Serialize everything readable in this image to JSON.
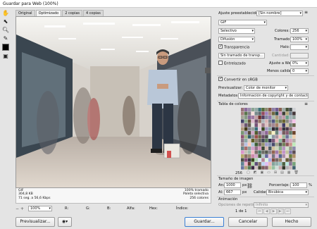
{
  "window": {
    "title": "Guardar para Web (100%)"
  },
  "tabs": [
    {
      "label": "Original"
    },
    {
      "label": "Optimizado"
    },
    {
      "label": "2 copias"
    },
    {
      "label": "4 copias"
    }
  ],
  "status": {
    "format": "GIF",
    "size": "304,8 KB",
    "time": "71 seg. a 56,6 Kbps",
    "dither": "100% tramado",
    "palette": "Paleta selectiva",
    "colors": "256 colores"
  },
  "bottom": {
    "zoom": "100%",
    "r": "R:",
    "g": "G:",
    "b": "B:",
    "alpha": "Alfa:",
    "hex": "Hex:",
    "index": "Índice:"
  },
  "panel": {
    "preset_label": "Ajuste preestablecido:",
    "preset_value": "[Sin nombre]",
    "format": "GIF",
    "reduction": "Selectivo",
    "dither_algo": "Difusión",
    "colors_label": "Colores:",
    "colors_value": "256",
    "dither_label": "Tramado:",
    "dither_value": "100%",
    "transparency": "Transparencia",
    "halo_label": "Halo:",
    "transp_dither": "Sin tramado de transp...",
    "amount_label": "Cantidad:",
    "interlaced": "Entrelazado",
    "web_snap_label": "Ajuste a Web:",
    "web_snap_value": "0%",
    "lossy_label": "Menos calidad:",
    "lossy_value": "0",
    "convert_srgb": "Convertir en sRGB",
    "preview_label": "Previsualizar:",
    "preview_value": "Color de monitor",
    "metadata_label": "Metadatos:",
    "metadata_value": "Información de copyright y de contacto",
    "color_table_title": "Tabla de colores",
    "color_count": "256",
    "image_size_title": "Tamaño de imagen",
    "width_label": "An:",
    "width_value": "1000",
    "height_label": "Al:",
    "height_value": "667",
    "px": "px",
    "percent_label": "Porcentaje:",
    "percent_value": "100",
    "percent_unit": "%",
    "quality_label": "Calidad:",
    "quality_value": "Bicúbica",
    "animation_title": "Animación",
    "loop_label": "Opciones de repetición:",
    "loop_value": "Infinito",
    "frame_counter": "1 de 1"
  },
  "buttons": {
    "preview": "Previsualizar...",
    "save": "Guardar...",
    "cancel": "Cancelar",
    "done": "Hecho"
  },
  "photo_colors": {
    "floor": "#d8cfc4",
    "ceiling": "#f2f0ec",
    "storefront": "#3e4a52",
    "shirt": "#b9c7d8",
    "jeans": "#2c3644",
    "bag": "#e7e5df"
  }
}
